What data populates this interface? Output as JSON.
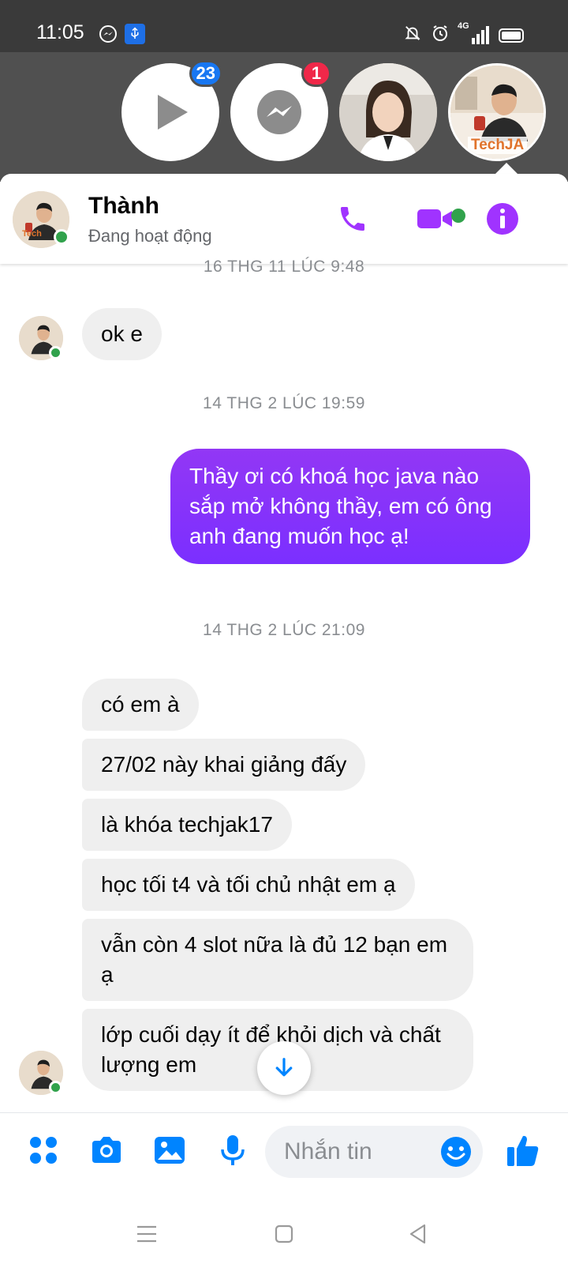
{
  "status_bar": {
    "time": "11:05",
    "network": "4G",
    "icons": [
      "messenger-icon",
      "usb-icon",
      "mute-icon",
      "alarm-icon",
      "signal-icon",
      "battery-icon"
    ]
  },
  "chat_heads": {
    "video_badge": "23",
    "messenger_badge": "1",
    "profile_logo_text": "TechJA",
    "video_badge_color": "#1877f2",
    "messenger_badge_color": "#f02849"
  },
  "header": {
    "name": "Thành",
    "status": "Đang hoạt động",
    "avatar_logo": "Tech",
    "accent": "#a033ff",
    "online_color": "#31a24c"
  },
  "messages": [
    {
      "type": "timestamp",
      "text": "16 THG 11 LÚC 9:48"
    },
    {
      "type": "incoming",
      "text": "ok e"
    },
    {
      "type": "timestamp",
      "text": "14 THG 2 LÚC 19:59"
    },
    {
      "type": "outgoing",
      "text": "Thầy ơi có khoá học java nào sắp mở không thầy, em có ông anh đang muốn học ạ!"
    },
    {
      "type": "timestamp",
      "text": "14 THG 2 LÚC 21:09"
    },
    {
      "type": "incoming",
      "text": "có em à"
    },
    {
      "type": "incoming",
      "text": "27/02 này khai giảng đấy"
    },
    {
      "type": "incoming",
      "text": "là khóa techjak17"
    },
    {
      "type": "incoming",
      "text": "học tối t4 và tối chủ nhật em ạ"
    },
    {
      "type": "incoming",
      "text": "vẫn còn 4 slot nữa là đủ 12 bạn em ạ"
    },
    {
      "type": "incoming",
      "text": "lớp cuối dạy ít để khỏi dịch và chất lượng em"
    }
  ],
  "composer": {
    "placeholder": "Nhắn tin",
    "accent": "#0084ff"
  }
}
